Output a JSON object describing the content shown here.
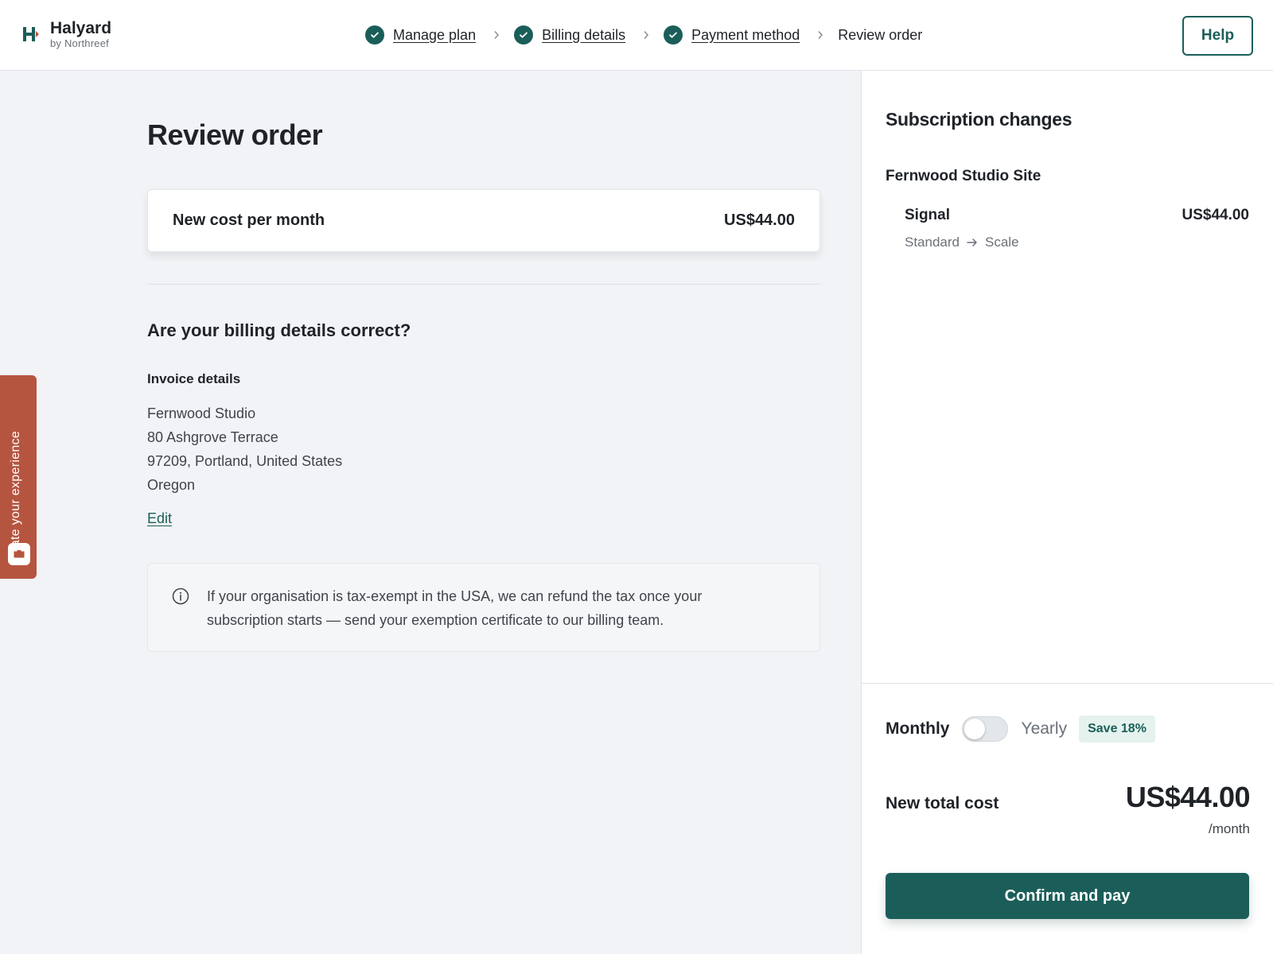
{
  "brand": {
    "name": "Halyard",
    "subtitle": "by Northreef"
  },
  "stepper": {
    "steps": [
      {
        "label": "Manage plan",
        "completed": true
      },
      {
        "label": "Billing details",
        "completed": true
      },
      {
        "label": "Payment method",
        "completed": true
      },
      {
        "label": "Review order",
        "completed": false
      }
    ]
  },
  "header": {
    "help_label": "Help"
  },
  "main": {
    "title": "Review order",
    "cost_card": {
      "label": "New cost per month",
      "value": "US$44.00"
    },
    "billing_question": "Are your billing details correct?",
    "invoice": {
      "label": "Invoice details",
      "lines": [
        "Fernwood Studio",
        "80 Ashgrove Terrace",
        "97209, Portland, United States",
        "Oregon"
      ],
      "edit_label": "Edit"
    },
    "info_text": "If your organisation is tax-exempt in the USA, we can refund the tax once your subscription starts — send your exemption certificate to our billing team."
  },
  "feedback": {
    "label": "Rate your experience"
  },
  "sidebar": {
    "title": "Subscription changes",
    "site": "Fernwood Studio Site",
    "item": {
      "name": "Signal",
      "price": "US$44.00",
      "from": "Standard",
      "to": "Scale"
    },
    "billing": {
      "monthly": "Monthly",
      "yearly": "Yearly",
      "save_badge": "Save 18%",
      "yearly_selected": false
    },
    "total": {
      "label": "New total cost",
      "value": "US$44.00",
      "unit": "/month"
    },
    "confirm_label": "Confirm and pay"
  },
  "colors": {
    "primary": "#1b5e59",
    "feedback": "#b6553f",
    "background": "#f1f3f6",
    "badge_bg": "#e5f2ee"
  },
  "icons": {
    "step_done": "check-circle-icon",
    "step_separator": "chevron-right-icon",
    "info": "info-icon",
    "arrow": "arrow-right-icon",
    "feedback": "feedback-icon"
  }
}
